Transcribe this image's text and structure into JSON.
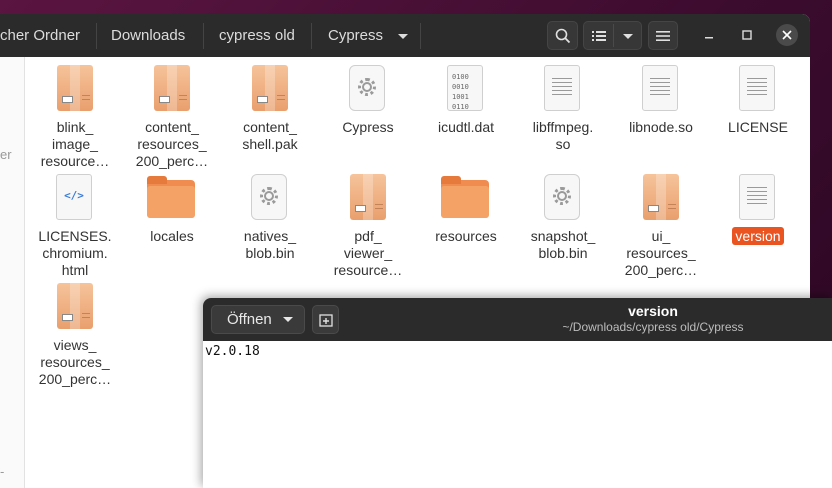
{
  "file_manager": {
    "breadcrumbs": [
      "cher Ordner",
      "Downloads",
      "cypress old",
      "Cypress"
    ],
    "sidebar_fragments": [
      "er",
      "-"
    ],
    "items": [
      {
        "label": "blink_\nimage_\nresource…",
        "icon": "archive-icon",
        "selected": false
      },
      {
        "label": "content_\nresources_\n200_perc…",
        "icon": "archive-icon",
        "selected": false
      },
      {
        "label": "content_\nshell.pak",
        "icon": "archive-icon",
        "selected": false
      },
      {
        "label": "Cypress",
        "icon": "executable-gear-icon",
        "selected": false
      },
      {
        "label": "icudtl.dat",
        "icon": "binary-file-icon",
        "selected": false
      },
      {
        "label": "libffmpeg.\nso",
        "icon": "text-file-icon",
        "selected": false
      },
      {
        "label": "libnode.so",
        "icon": "text-file-icon",
        "selected": false
      },
      {
        "label": "LICENSE",
        "icon": "text-file-icon",
        "selected": false
      },
      {
        "label": "LICENSES.\nchromium.\nhtml",
        "icon": "html-file-icon",
        "selected": false
      },
      {
        "label": "locales",
        "icon": "folder-icon",
        "selected": false
      },
      {
        "label": "natives_\nblob.bin",
        "icon": "executable-gear-icon",
        "selected": false
      },
      {
        "label": "pdf_\nviewer_\nresource…",
        "icon": "archive-icon",
        "selected": false
      },
      {
        "label": "resources",
        "icon": "folder-icon",
        "selected": false
      },
      {
        "label": "snapshot_\nblob.bin",
        "icon": "executable-gear-icon",
        "selected": false
      },
      {
        "label": "ui_\nresources_\n200_perc…",
        "icon": "archive-icon",
        "selected": false
      },
      {
        "label": "version",
        "icon": "text-file-icon",
        "selected": true
      },
      {
        "label": "views_\nresources_\n200_perc…",
        "icon": "archive-icon",
        "selected": false
      }
    ]
  },
  "editor": {
    "open_label": "Öffnen",
    "title": "version",
    "subtitle": "~/Downloads/cypress old/Cypress",
    "content": "v2.0.18"
  },
  "colors": {
    "accent": "#e95420",
    "header": "#2b2b2b",
    "folder": "#f5a266"
  }
}
